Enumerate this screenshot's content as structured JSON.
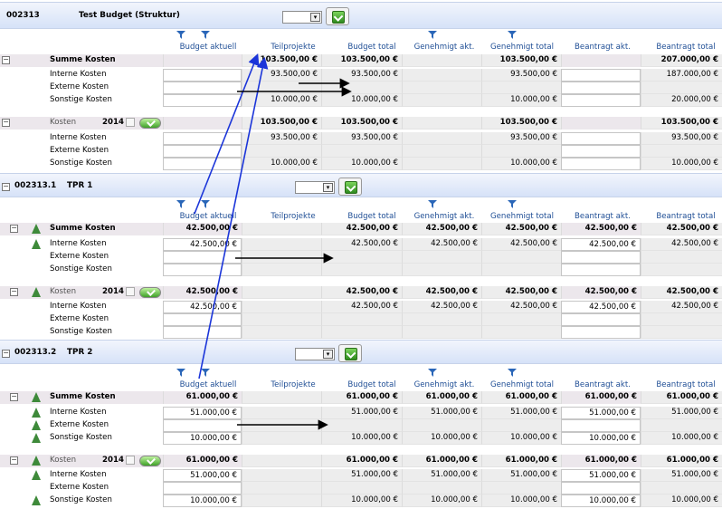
{
  "columns": [
    "Budget aktuell",
    "Teilprojekte",
    "Budget total",
    "Genehmigt akt.",
    "Genehmigt total",
    "Beantragt akt.",
    "Beantragt total"
  ],
  "year": "2014",
  "kosten_label": "Kosten",
  "sections": [
    {
      "id": "002313",
      "name": "Test Budget (Struktur)",
      "sum": {
        "label": "Summe Kosten",
        "values": [
          "",
          "103.500,00 €",
          "103.500,00 €",
          "",
          "103.500,00 €",
          "",
          "207.000,00 €"
        ]
      },
      "rows": [
        {
          "label": "Interne Kosten",
          "values": [
            "",
            "93.500,00 €",
            "93.500,00 €",
            "",
            "93.500,00 €",
            "",
            "187.000,00 €"
          ]
        },
        {
          "label": "Externe Kosten",
          "values": [
            "",
            "",
            "",
            "",
            "",
            "",
            ""
          ]
        },
        {
          "label": "Sonstige Kosten",
          "values": [
            "",
            "10.000,00 €",
            "10.000,00 €",
            "",
            "10.000,00 €",
            "",
            "20.000,00 €"
          ]
        }
      ],
      "kosten": {
        "values": [
          "",
          "103.500,00 €",
          "103.500,00 €",
          "",
          "103.500,00 €",
          "",
          "103.500,00 €"
        ]
      },
      "krows": [
        {
          "label": "Interne Kosten",
          "values": [
            "",
            "93.500,00 €",
            "93.500,00 €",
            "",
            "93.500,00 €",
            "",
            "93.500,00 €"
          ]
        },
        {
          "label": "Externe Kosten",
          "values": [
            "",
            "",
            "",
            "",
            "",
            "",
            ""
          ]
        },
        {
          "label": "Sonstige Kosten",
          "values": [
            "",
            "10.000,00 €",
            "10.000,00 €",
            "",
            "10.000,00 €",
            "",
            "10.000,00 €"
          ]
        }
      ]
    },
    {
      "id": "002313.1",
      "name": "TPR 1",
      "sum": {
        "label": "Summe Kosten",
        "values": [
          "42.500,00 €",
          "",
          "42.500,00 €",
          "42.500,00 €",
          "42.500,00 €",
          "42.500,00 €",
          "42.500,00 €"
        ]
      },
      "rows": [
        {
          "label": "Interne Kosten",
          "values": [
            "42.500,00 €",
            "",
            "42.500,00 €",
            "42.500,00 €",
            "42.500,00 €",
            "42.500,00 €",
            "42.500,00 €"
          ]
        },
        {
          "label": "Externe Kosten",
          "values": [
            "",
            "",
            "",
            "",
            "",
            "",
            ""
          ]
        },
        {
          "label": "Sonstige Kosten",
          "values": [
            "",
            "",
            "",
            "",
            "",
            "",
            ""
          ]
        }
      ],
      "kosten": {
        "values": [
          "42.500,00 €",
          "",
          "42.500,00 €",
          "42.500,00 €",
          "42.500,00 €",
          "42.500,00 €",
          "42.500,00 €"
        ]
      },
      "krows": [
        {
          "label": "Interne Kosten",
          "values": [
            "42.500,00 €",
            "",
            "42.500,00 €",
            "42.500,00 €",
            "42.500,00 €",
            "42.500,00 €",
            "42.500,00 €"
          ]
        },
        {
          "label": "Externe Kosten",
          "values": [
            "",
            "",
            "",
            "",
            "",
            "",
            ""
          ]
        },
        {
          "label": "Sonstige Kosten",
          "values": [
            "",
            "",
            "",
            "",
            "",
            "",
            ""
          ]
        }
      ]
    },
    {
      "id": "002313.2",
      "name": "TPR 2",
      "sum": {
        "label": "Summe Kosten",
        "values": [
          "61.000,00 €",
          "",
          "61.000,00 €",
          "61.000,00 €",
          "61.000,00 €",
          "61.000,00 €",
          "61.000,00 €"
        ]
      },
      "rows": [
        {
          "label": "Interne Kosten",
          "values": [
            "51.000,00 €",
            "",
            "51.000,00 €",
            "51.000,00 €",
            "51.000,00 €",
            "51.000,00 €",
            "51.000,00 €"
          ]
        },
        {
          "label": "Externe Kosten",
          "values": [
            "",
            "",
            "",
            "",
            "",
            "",
            ""
          ]
        },
        {
          "label": "Sonstige Kosten",
          "values": [
            "10.000,00 €",
            "",
            "10.000,00 €",
            "10.000,00 €",
            "10.000,00 €",
            "10.000,00 €",
            "10.000,00 €"
          ]
        }
      ],
      "kosten": {
        "values": [
          "61.000,00 €",
          "",
          "61.000,00 €",
          "61.000,00 €",
          "61.000,00 €",
          "61.000,00 €",
          "61.000,00 €"
        ]
      },
      "krows": [
        {
          "label": "Interne Kosten",
          "values": [
            "51.000,00 €",
            "",
            "51.000,00 €",
            "51.000,00 €",
            "51.000,00 €",
            "51.000,00 €",
            "51.000,00 €"
          ]
        },
        {
          "label": "Externe Kosten",
          "values": [
            "",
            "",
            "",
            "",
            "",
            "",
            ""
          ]
        },
        {
          "label": "Sonstige Kosten",
          "values": [
            "10.000,00 €",
            "",
            "10.000,00 €",
            "10.000,00 €",
            "10.000,00 €",
            "10.000,00 €",
            "10.000,00 €"
          ]
        }
      ]
    }
  ],
  "colors": {
    "header_gradient_top": "#f2f5fc",
    "header_gradient_bottom": "#d6e2f8",
    "column_header_text": "#1f4e95",
    "sum_row_bg": "#ece7ec",
    "annotation_blue": "#1b35d9",
    "annotation_black": "#000000"
  },
  "icons": [
    "filter-icon",
    "dropdown-arrow-icon",
    "green-check-button-icon",
    "collapse-icon",
    "tree-node-icon",
    "checkbox-icon",
    "confirm-button-icon"
  ]
}
